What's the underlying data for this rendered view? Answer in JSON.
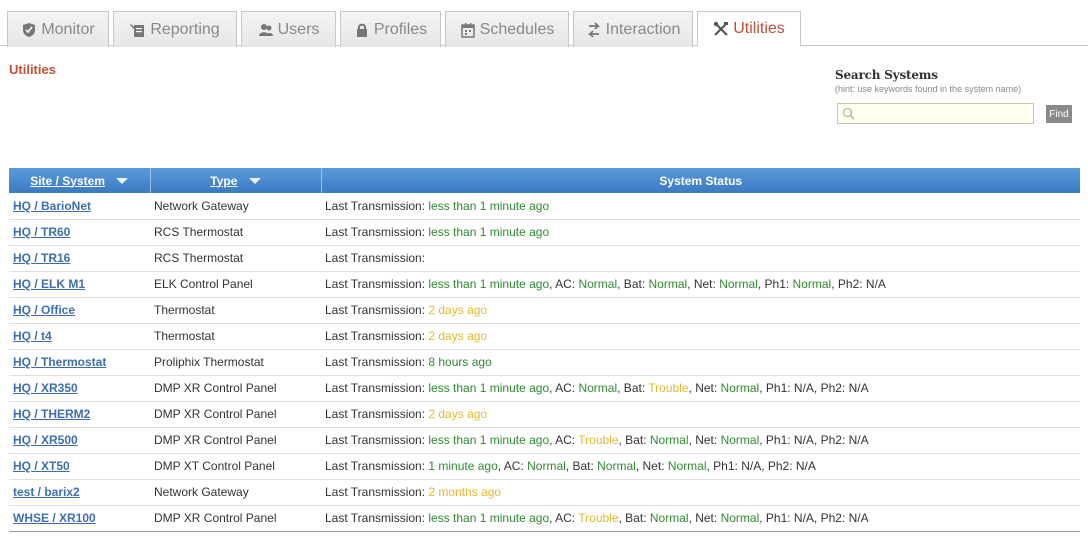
{
  "tabs": [
    {
      "label": "Monitor",
      "icon": "shield-icon",
      "active": false
    },
    {
      "label": "Reporting",
      "icon": "wrench-report-icon",
      "active": false
    },
    {
      "label": "Users",
      "icon": "users-icon",
      "active": false
    },
    {
      "label": "Profiles",
      "icon": "lock-icon",
      "active": false
    },
    {
      "label": "Schedules",
      "icon": "calendar-icon",
      "active": false
    },
    {
      "label": "Interaction",
      "icon": "arrows-icon",
      "active": false
    },
    {
      "label": "Utilities",
      "icon": "tools-icon",
      "active": true
    }
  ],
  "page": {
    "title": "Utilities"
  },
  "search": {
    "title": "Search Systems",
    "hint": "(hint: use keywords found in the system name)",
    "value": "",
    "find_label": "Find"
  },
  "table": {
    "headers": {
      "site": "Site / System",
      "type": "Type",
      "status": "System Status"
    },
    "rows": [
      {
        "site": "HQ / BarioNet",
        "type": "Network Gateway",
        "status": [
          [
            "Last Transmission: ",
            "na"
          ],
          [
            "less than 1 minute ago",
            "ok"
          ]
        ]
      },
      {
        "site": "HQ / TR60",
        "type": "RCS Thermostat",
        "status": [
          [
            "Last Transmission: ",
            "na"
          ],
          [
            "less than 1 minute ago",
            "ok"
          ]
        ]
      },
      {
        "site": "HQ / TR16",
        "type": "RCS Thermostat",
        "status": [
          [
            "Last Transmission:",
            "na"
          ]
        ]
      },
      {
        "site": "HQ / ELK M1",
        "type": "ELK Control Panel",
        "status": [
          [
            "Last Transmission: ",
            "na"
          ],
          [
            "less than 1 minute ago",
            "ok"
          ],
          [
            ", AC: ",
            "na"
          ],
          [
            "Normal",
            "ok"
          ],
          [
            ", Bat: ",
            "na"
          ],
          [
            "Normal",
            "ok"
          ],
          [
            ", Net: ",
            "na"
          ],
          [
            "Normal",
            "ok"
          ],
          [
            ", Ph1: ",
            "na"
          ],
          [
            "Normal",
            "ok"
          ],
          [
            ", Ph2: N/A",
            "na"
          ]
        ]
      },
      {
        "site": "HQ / Office",
        "type": "Thermostat",
        "status": [
          [
            "Last Transmission: ",
            "na"
          ],
          [
            "2 days ago",
            "warn"
          ]
        ]
      },
      {
        "site": "HQ / t4",
        "type": "Thermostat",
        "status": [
          [
            "Last Transmission: ",
            "na"
          ],
          [
            "2 days ago",
            "warn"
          ]
        ]
      },
      {
        "site": "HQ / Thermostat",
        "type": "Proliphix Thermostat",
        "status": [
          [
            "Last Transmission: ",
            "na"
          ],
          [
            "8 hours ago",
            "ok"
          ]
        ]
      },
      {
        "site": "HQ / XR350",
        "type": "DMP XR Control Panel",
        "status": [
          [
            "Last Transmission: ",
            "na"
          ],
          [
            "less than 1 minute ago",
            "ok"
          ],
          [
            ", AC: ",
            "na"
          ],
          [
            "Normal",
            "ok"
          ],
          [
            ", Bat: ",
            "na"
          ],
          [
            "Trouble",
            "warn"
          ],
          [
            ", Net: ",
            "na"
          ],
          [
            "Normal",
            "ok"
          ],
          [
            ", Ph1: N/A, Ph2: N/A",
            "na"
          ]
        ]
      },
      {
        "site": "HQ / THERM2",
        "type": "DMP XR Control Panel",
        "status": [
          [
            "Last Transmission: ",
            "na"
          ],
          [
            "2 days ago",
            "warn"
          ]
        ]
      },
      {
        "site": "HQ / XR500",
        "type": "DMP XR Control Panel",
        "status": [
          [
            "Last Transmission: ",
            "na"
          ],
          [
            "less than 1 minute ago",
            "ok"
          ],
          [
            ", AC: ",
            "na"
          ],
          [
            "Trouble",
            "warn"
          ],
          [
            ", Bat: ",
            "na"
          ],
          [
            "Normal",
            "ok"
          ],
          [
            ", Net: ",
            "na"
          ],
          [
            "Normal",
            "ok"
          ],
          [
            ", Ph1: N/A, Ph2: N/A",
            "na"
          ]
        ]
      },
      {
        "site": "HQ / XT50",
        "type": "DMP XT Control Panel",
        "status": [
          [
            "Last Transmission: ",
            "na"
          ],
          [
            "1 minute ago",
            "ok"
          ],
          [
            ", AC: ",
            "na"
          ],
          [
            "Normal",
            "ok"
          ],
          [
            ", Bat: ",
            "na"
          ],
          [
            "Normal",
            "ok"
          ],
          [
            ", Net: ",
            "na"
          ],
          [
            "Normal",
            "ok"
          ],
          [
            ", Ph1: N/A, Ph2: N/A",
            "na"
          ]
        ]
      },
      {
        "site": "test / barix2",
        "type": "Network Gateway",
        "status": [
          [
            "Last Transmission: ",
            "na"
          ],
          [
            "2 months ago",
            "warn"
          ]
        ]
      },
      {
        "site": "WHSE / XR100",
        "type": "DMP XR Control Panel",
        "status": [
          [
            "Last Transmission: ",
            "na"
          ],
          [
            "less than 1 minute ago",
            "ok"
          ],
          [
            ", AC: ",
            "na"
          ],
          [
            "Trouble",
            "warn"
          ],
          [
            ", Bat: ",
            "na"
          ],
          [
            "Normal",
            "ok"
          ],
          [
            ", Net: ",
            "na"
          ],
          [
            "Normal",
            "ok"
          ],
          [
            ", Ph1: N/A, Ph2: N/A",
            "na"
          ]
        ]
      }
    ]
  },
  "colors": {
    "accent": "#c0503a",
    "header_blue": "#4a8ad0",
    "ok": "#2e8b2e",
    "warn": "#e5b92c",
    "link": "#3d6fae"
  }
}
